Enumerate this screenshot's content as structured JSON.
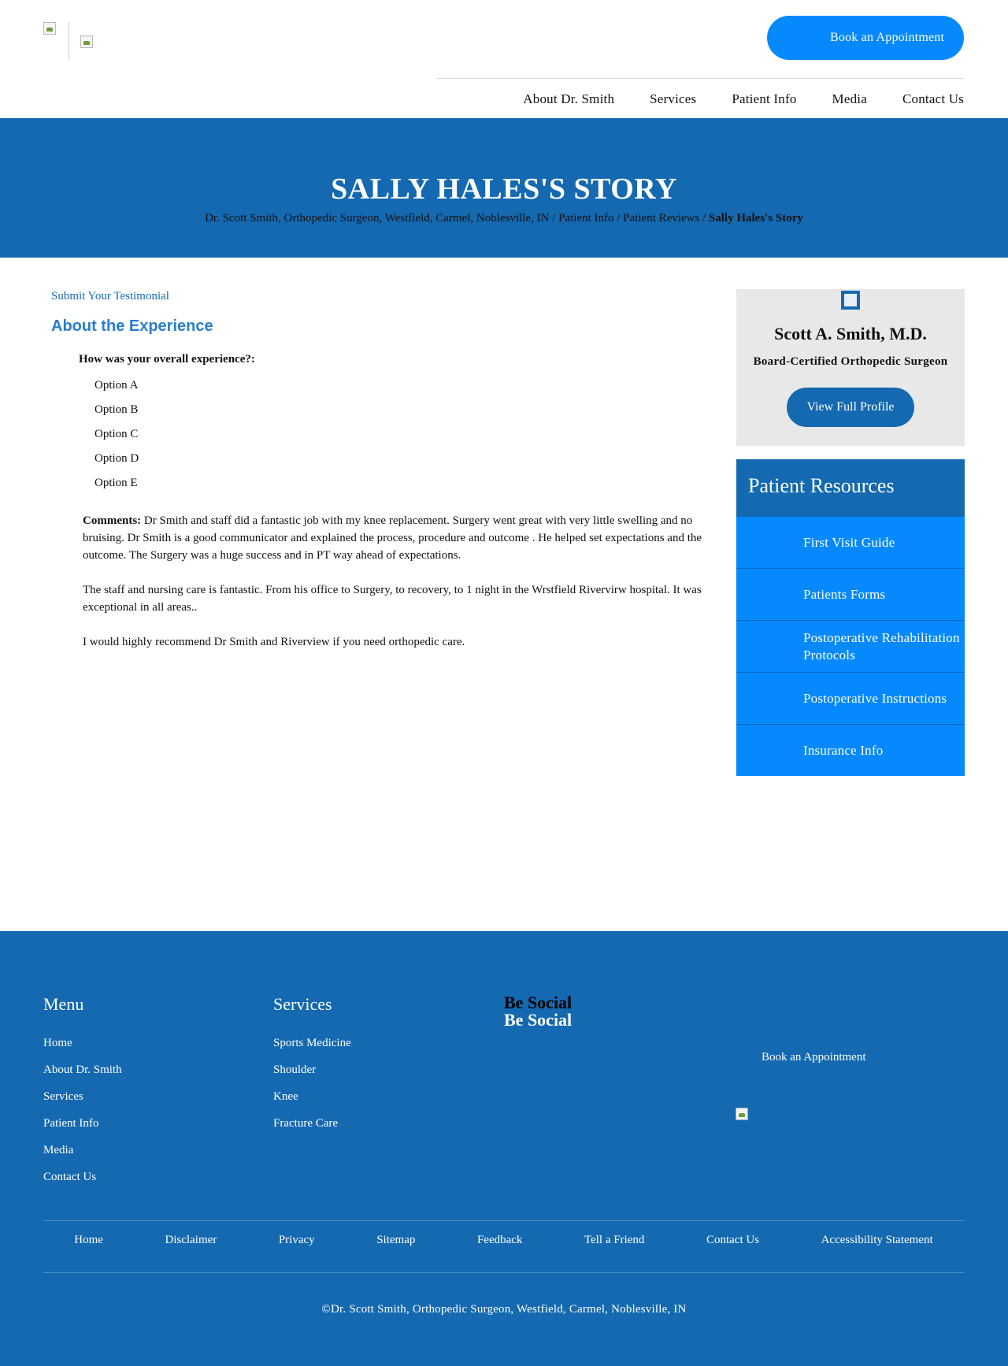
{
  "header": {
    "book_label": "Book an Appointment",
    "nav": [
      "About Dr. Smith",
      "Services",
      "Patient Info",
      "Media",
      "Contact Us"
    ]
  },
  "hero": {
    "title": "SALLY HALES'S STORY",
    "breadcrumb": {
      "home": "Dr. Scott Smith, Orthopedic Surgeon, Westfield, Carmel, Noblesville, IN",
      "patient_info": "Patient Info",
      "patient_reviews": "Patient Reviews",
      "current": "Sally Hales's Story",
      "separator": "/"
    }
  },
  "content": {
    "submit_link": "Submit Your Testimonial",
    "section_title": "About the Experience",
    "question": "How was your overall experience?:",
    "options": [
      "Option A",
      "Option B",
      "Option C",
      "Option D",
      "Option E"
    ],
    "comments_label": "Comments:",
    "comments_p1": "Dr Smith and staff did a fantastic job with my knee replacement. Surgery went great with very little swelling and no bruising. Dr Smith is a good communicator and explained the process, procedure and outcome . He helped set expectations and the outcome. The Surgery was a huge success and in PT way ahead of expectations.",
    "comments_p2": "The staff and nursing care is fantastic. From his office to Surgery, to recovery, to 1 night in the Wrstfield Rivervirw hospital. It was exceptional in all areas..",
    "comments_p3": "I would highly recommend Dr Smith and Riverview if you need orthopedic care."
  },
  "sidebar": {
    "profile_name": "Scott A. Smith, M.D.",
    "profile_title": "Board-Certified Orthopedic Surgeon",
    "profile_button": "View Full Profile",
    "resources_title": "Patient Resources",
    "resources": [
      "First Visit Guide",
      "Patients Forms",
      "Postoperative Rehabilitation Protocols",
      "Postoperative Instructions",
      "Insurance Info"
    ]
  },
  "footer": {
    "menu_title": "Menu",
    "menu": [
      "Home",
      "About Dr. Smith",
      "Services",
      "Patient Info",
      "Media",
      "Contact Us"
    ],
    "services_title": "Services",
    "services": [
      "Sports Medicine",
      "Shoulder",
      "Knee",
      "Fracture Care"
    ],
    "social_title": "Be Social",
    "social_title_2": "Be Social",
    "book_label": "Book an Appointment",
    "bottom_nav": [
      "Home",
      "Disclaimer",
      "Privacy",
      "Sitemap",
      "Feedback",
      "Tell a Friend",
      "Contact Us",
      "Accessibility Statement"
    ],
    "copyright": "©Dr. Scott Smith, Orthopedic Surgeon, Westfield, Carmel, Noblesville, IN"
  },
  "colors": {
    "primary_blue": "#1469b0",
    "bright_blue": "#0589fd",
    "link_blue": "#2a7dcc",
    "card_gray": "#e8e8e8"
  }
}
